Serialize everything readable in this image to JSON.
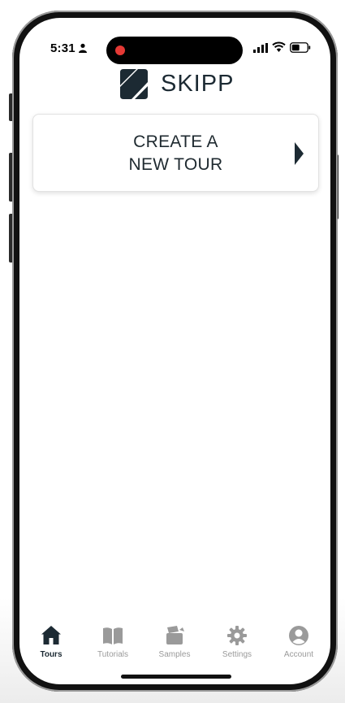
{
  "status_bar": {
    "time": "5:31"
  },
  "header": {
    "logo_text": "SKIPP"
  },
  "create_card": {
    "line1": "CREATE A",
    "line2": "NEW TOUR"
  },
  "tabs": [
    {
      "label": "Tours",
      "icon": "home-icon",
      "active": true
    },
    {
      "label": "Tutorials",
      "icon": "book-icon",
      "active": false
    },
    {
      "label": "Samples",
      "icon": "samples-icon",
      "active": false
    },
    {
      "label": "Settings",
      "icon": "gear-icon",
      "active": false
    },
    {
      "label": "Account",
      "icon": "account-icon",
      "active": false
    }
  ],
  "colors": {
    "brand_dark": "#1c2a33",
    "inactive_tab": "#9a9a9a",
    "record_dot": "#e53935"
  }
}
